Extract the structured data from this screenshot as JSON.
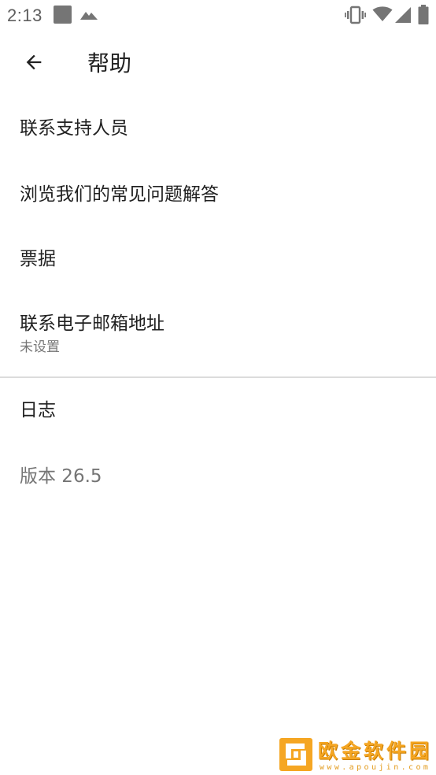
{
  "status_bar": {
    "time": "2:13",
    "icons": [
      "notification-square-icon",
      "photo-notification-icon",
      "vibrate-icon",
      "wifi-icon",
      "cell-signal-icon",
      "battery-icon"
    ]
  },
  "toolbar": {
    "title": "帮助",
    "back_icon": "arrow-back-icon"
  },
  "items": [
    {
      "title": "联系支持人员"
    },
    {
      "title": "浏览我们的常见问题解答"
    },
    {
      "title": "票据"
    },
    {
      "title": "联系电子邮箱地址",
      "summary": "未设置"
    },
    {
      "title": "日志"
    },
    {
      "title": "版本 26.5"
    }
  ],
  "watermark": {
    "text": "欧金软件园",
    "url": "www.apoujin.com"
  },
  "colors": {
    "text_primary": "#212121",
    "text_secondary": "#757575",
    "divider": "#dcdcdc",
    "watermark": "#f5a623"
  }
}
